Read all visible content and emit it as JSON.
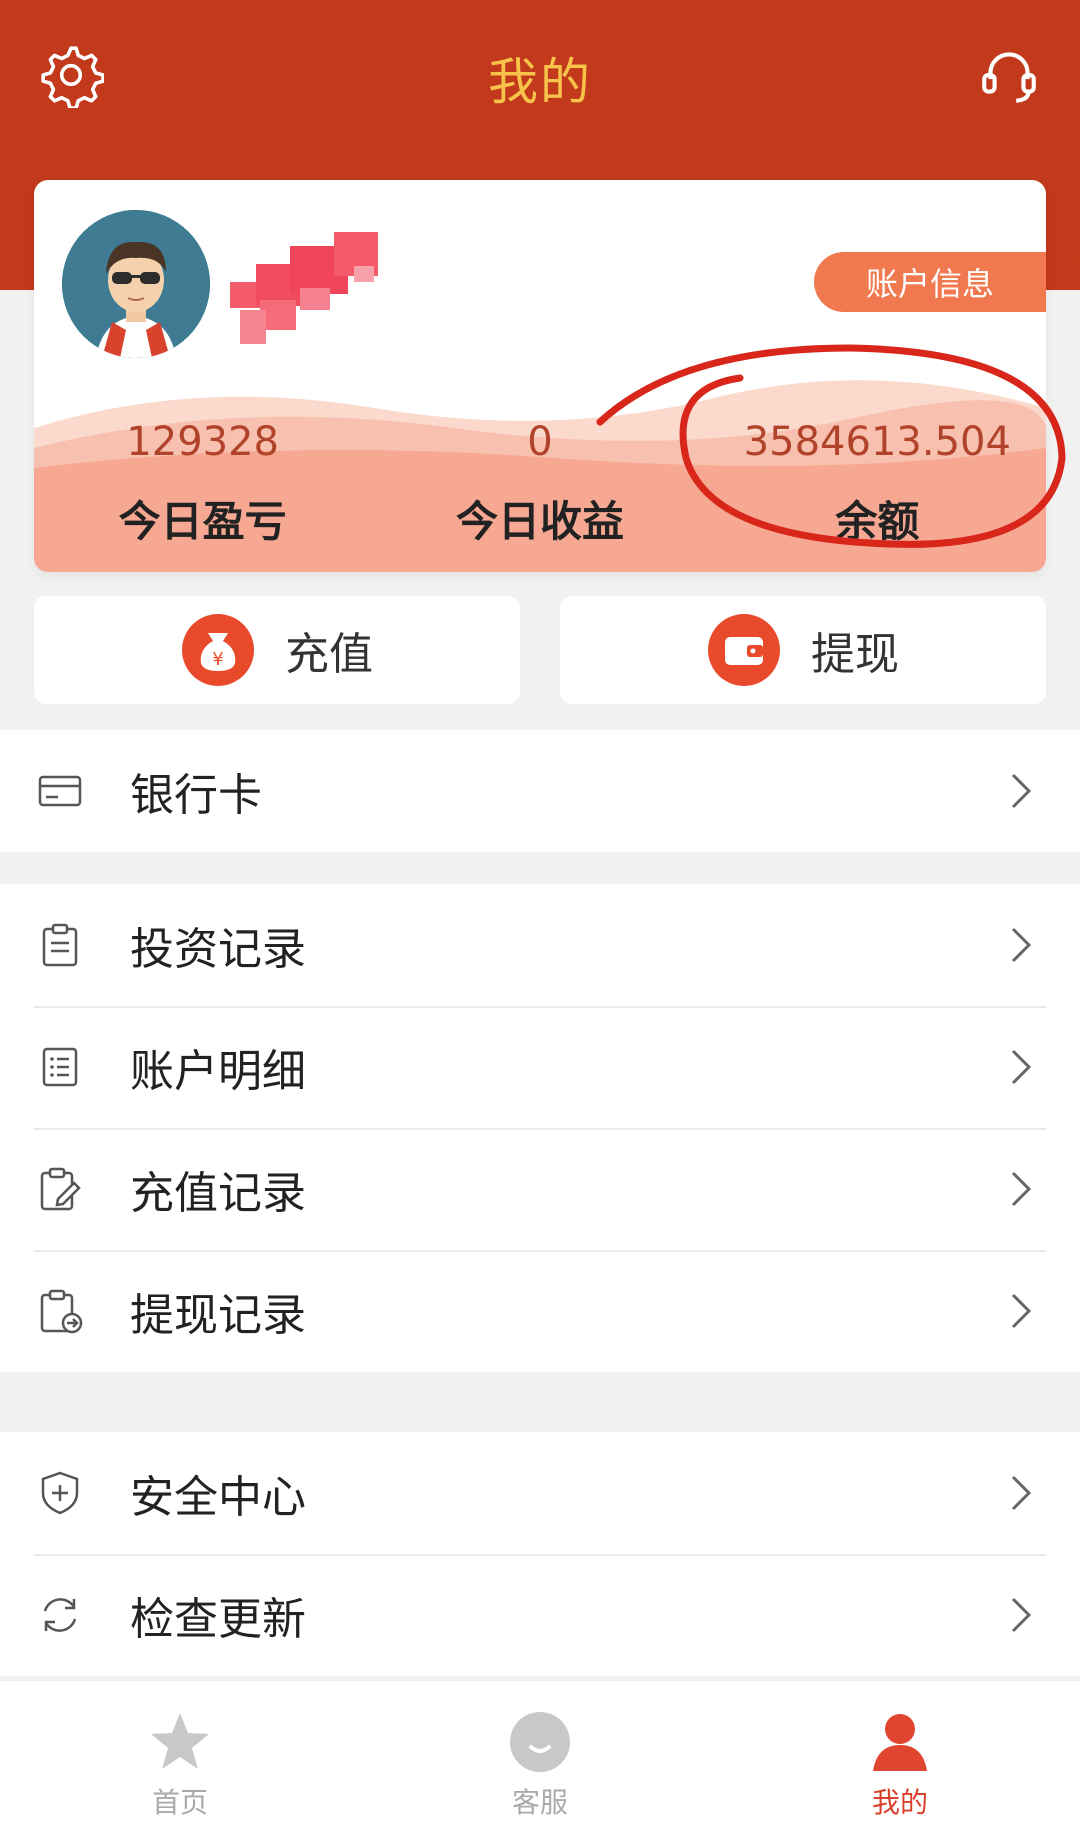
{
  "header": {
    "title": "我的",
    "left_icon": "settings-gear-icon",
    "right_icon": "headset-icon",
    "bg_color": "#c2391b",
    "title_color": "#f7c34a"
  },
  "profile": {
    "account_info_label": "账户信息"
  },
  "stats": [
    {
      "value": "129328",
      "label": "今日盈亏"
    },
    {
      "value": "0",
      "label": "今日收益"
    },
    {
      "value": "3584613.504",
      "label": "余额"
    }
  ],
  "actions": {
    "recharge_label": "充值",
    "withdraw_label": "提现",
    "accent_color": "#ea4a2c"
  },
  "menu_groups": [
    [
      {
        "label": "银行卡",
        "icon": "bank-card-icon"
      }
    ],
    [
      {
        "label": "投资记录",
        "icon": "clipboard-icon"
      },
      {
        "label": "账户明细",
        "icon": "list-icon"
      },
      {
        "label": "充值记录",
        "icon": "edit-doc-icon"
      },
      {
        "label": "提现记录",
        "icon": "doc-export-icon"
      }
    ],
    [
      {
        "label": "安全中心",
        "icon": "shield-icon"
      },
      {
        "label": "检查更新",
        "icon": "refresh-icon"
      }
    ]
  ],
  "tabbar": [
    {
      "label": "首页",
      "icon": "star-icon"
    },
    {
      "label": "客服",
      "icon": "chat-icon"
    },
    {
      "label": "我的",
      "icon": "person-icon",
      "active": true
    }
  ]
}
